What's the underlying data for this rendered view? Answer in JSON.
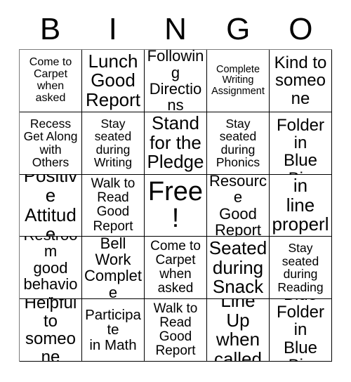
{
  "card": {
    "header_letters": [
      "B",
      "I",
      "N",
      "G",
      "O"
    ],
    "rows": [
      [
        {
          "text": "Come to\nCarpet\nwhen\nasked",
          "size": "fs-12"
        },
        {
          "text": "Lunch\nGood\nReport",
          "size": "fs-20"
        },
        {
          "text": "Following\nDirections",
          "size": "fs-16"
        },
        {
          "text": "Complete\nWriting\nAssignment",
          "size": "fs-11"
        },
        {
          "text": "Kind to\nsomeone",
          "size": "fs-18"
        }
      ],
      [
        {
          "text": "Recess\nGet Along\nwith\nOthers",
          "size": "fs-13"
        },
        {
          "text": "Stay\nseated\nduring\nWriting",
          "size": "fs-13"
        },
        {
          "text": "Stand\nfor the\nPledge",
          "size": "fs-20"
        },
        {
          "text": "Stay\nseated\nduring\nPhonics",
          "size": "fs-13"
        },
        {
          "text": "Blue\nFolder in\nBlue Bin",
          "size": "fs-18"
        }
      ],
      [
        {
          "text": "Positive\nAttitude",
          "size": "fs-20"
        },
        {
          "text": "Walk to\nRead\nGood\nReport",
          "size": "fs-14"
        },
        {
          "text": "Free!",
          "size": "fs-free"
        },
        {
          "text": "Resource\nGood\nReport",
          "size": "fs-16"
        },
        {
          "text": "Walk in\nline\nproperly",
          "size": "fs-20"
        }
      ],
      [
        {
          "text": "Restroom\ngood\nbehavior",
          "size": "fs-16"
        },
        {
          "text": "Bell Work\nComplete",
          "size": "fs-16"
        },
        {
          "text": "Come to\nCarpet\nwhen\nasked",
          "size": "fs-14"
        },
        {
          "text": "Seated\nduring\nSnack",
          "size": "fs-20"
        },
        {
          "text": "Stay\nseated\nduring\nReading",
          "size": "fs-13"
        }
      ],
      [
        {
          "text": "Helpful\nto\nsomeone",
          "size": "fs-18"
        },
        {
          "text": "Participate\nin Math",
          "size": "fs-15"
        },
        {
          "text": "Walk to\nRead\nGood\nReport",
          "size": "fs-14"
        },
        {
          "text": "Line Up\nwhen\ncalled",
          "size": "fs-20"
        },
        {
          "text": "Blue\nFolder in\nBlue Bin",
          "size": "fs-18"
        }
      ]
    ]
  }
}
